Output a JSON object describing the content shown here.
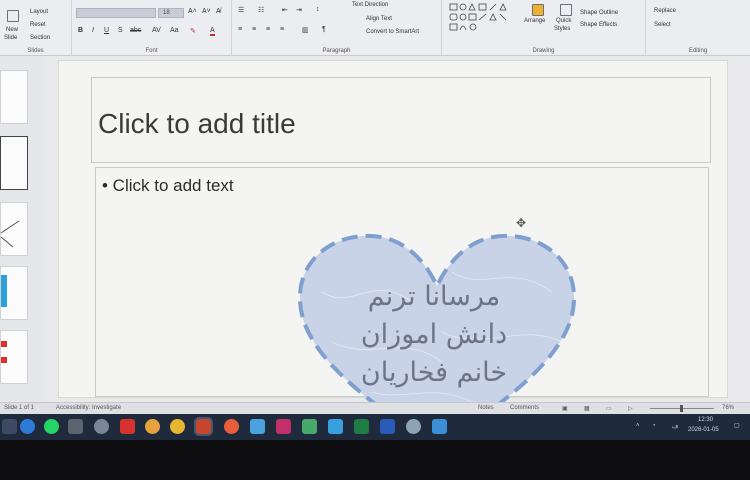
{
  "ribbon": {
    "slides_group": {
      "new_slide": "New",
      "new_slide_2": "Slide",
      "layout": "Layout",
      "reset": "Reset",
      "section": "Section",
      "label": "Slides"
    },
    "font_group": {
      "label": "Font",
      "size": "18"
    },
    "paragraph_group": {
      "text_direction": "Text Direction",
      "align_text": "Align Text",
      "convert_smartart": "Convert to SmartArt",
      "label": "Paragraph"
    },
    "drawing_group": {
      "arrange": "Arrange",
      "quick_styles": "Quick",
      "quick_styles_2": "Styles",
      "shape_outline": "Shape Outline",
      "shape_effects": "Shape Effects",
      "label": "Drawing"
    },
    "editing_group": {
      "replace": "Replace",
      "select": "Select",
      "label": "Editing"
    }
  },
  "slide": {
    "title_placeholder": "Click to add title",
    "body_placeholder": "• Click to add text",
    "heart_text": [
      "مرسانا ترنم",
      "دانش اموزان",
      "خانم فخاریان"
    ]
  },
  "statusbar": {
    "left": "Slide 1 of 1",
    "accessibility": "Accessibility: Investigate",
    "notes": "Notes",
    "comments": "Comments",
    "zoom": "76%"
  },
  "taskbar": {
    "time": "12:30",
    "date": "2026-01-05"
  },
  "colors": {
    "heart_fill": "#c9d3e7",
    "heart_stroke": "#7f9fd0",
    "heart_text": "#6d7485",
    "taskbar": "#1f2b3d"
  }
}
